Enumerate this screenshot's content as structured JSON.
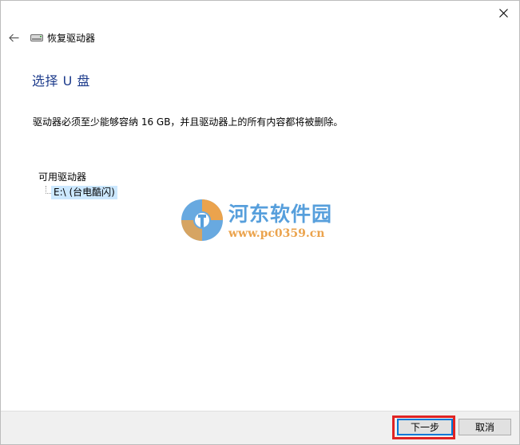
{
  "window": {
    "nav_title": "恢复驱动器",
    "page_title": "选择 U 盘",
    "description": "驱动器必须至少能够容纳 16 GB，并且驱动器上的所有内容都将被删除。"
  },
  "drives": {
    "label": "可用驱动器",
    "items": [
      {
        "label": "E:\\ (台电酷闪)",
        "selected": true
      }
    ]
  },
  "watermark": {
    "name": "河东软件园",
    "url": "www.pc0359.cn"
  },
  "footer": {
    "next_label": "下一步",
    "cancel_label": "取消"
  },
  "icons": {
    "close": "close-icon",
    "back": "back-arrow-icon",
    "drive": "drive-icon",
    "logo": "logo-icon"
  },
  "colors": {
    "title": "#1e3c8c",
    "selection": "#cce8ff",
    "highlight": "#e02424",
    "accent": "#0078d7"
  }
}
